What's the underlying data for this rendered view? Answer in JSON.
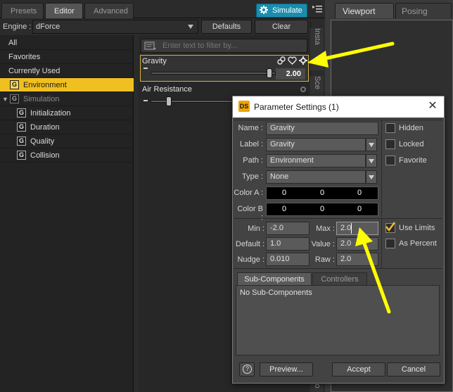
{
  "tabs": [
    {
      "label": "Presets"
    },
    {
      "label": "Editor"
    },
    {
      "label": "Advanced"
    }
  ],
  "simulate_label": "Simulate",
  "engine": {
    "label": "Engine :",
    "value": "dForce"
  },
  "buttons": {
    "defaults": "Defaults",
    "clear": "Clear"
  },
  "sidebar": {
    "items": [
      {
        "label": "All"
      },
      {
        "label": "Favorites"
      },
      {
        "label": "Currently Used"
      },
      {
        "label": "Environment"
      },
      {
        "label": "Simulation"
      },
      {
        "label": "Initialization"
      },
      {
        "label": "Duration"
      },
      {
        "label": "Quality"
      },
      {
        "label": "Collision"
      }
    ],
    "group_glyph": "G"
  },
  "filter": {
    "placeholder": "Enter text to filter by..."
  },
  "properties": {
    "gravity": {
      "label": "Gravity",
      "value": "2.00",
      "slider_fraction": 0.95
    },
    "air_resistance": {
      "label": "Air Resistance",
      "slider_fraction": 0.2
    }
  },
  "side_tabs": {
    "top": "Insta",
    "middle": "Sce",
    "bottom": "tio"
  },
  "viewport_tabs": {
    "viewport": "Viewport",
    "posing": "Posing"
  },
  "dialog": {
    "title": "Parameter Settings (1)",
    "icon_text": "DS",
    "name": {
      "label": "Name :",
      "value": "Gravity"
    },
    "label": {
      "label": "Label :",
      "value": "Gravity"
    },
    "path": {
      "label": "Path :",
      "value": "Environment"
    },
    "type": {
      "label": "Type :",
      "value": "None"
    },
    "color_a": {
      "label": "Color A :",
      "values": [
        "0",
        "0",
        "0"
      ]
    },
    "color_b": {
      "label": "Color B :",
      "values": [
        "0",
        "0",
        "0"
      ]
    },
    "checkboxes": {
      "hidden": {
        "label": "Hidden",
        "checked": false
      },
      "locked": {
        "label": "Locked",
        "checked": false
      },
      "favorite": {
        "label": "Favorite",
        "checked": false
      },
      "use_limits": {
        "label": "Use Limits",
        "checked": true
      },
      "as_percent": {
        "label": "As Percent",
        "checked": false
      }
    },
    "min": {
      "label": "Min :",
      "value": "-2.0"
    },
    "max": {
      "label": "Max :",
      "value": "2.0"
    },
    "default": {
      "label": "Default :",
      "value": "1.0"
    },
    "value": {
      "label": "Value :",
      "value": "2.0"
    },
    "nudge": {
      "label": "Nudge :",
      "value": "0.010"
    },
    "raw": {
      "label": "Raw :",
      "value": "2.0"
    },
    "subtabs": {
      "subcomponents": "Sub-Components",
      "controllers": "Controllers"
    },
    "subpanel_text": "No Sub-Components",
    "help_glyph": "?",
    "preview": "Preview...",
    "accept": "Accept",
    "cancel": "Cancel"
  },
  "colors": {
    "accent_yellow": "#f0c020",
    "simulate_blue": "#1a8dae",
    "arrow_yellow": "#ffff00"
  }
}
